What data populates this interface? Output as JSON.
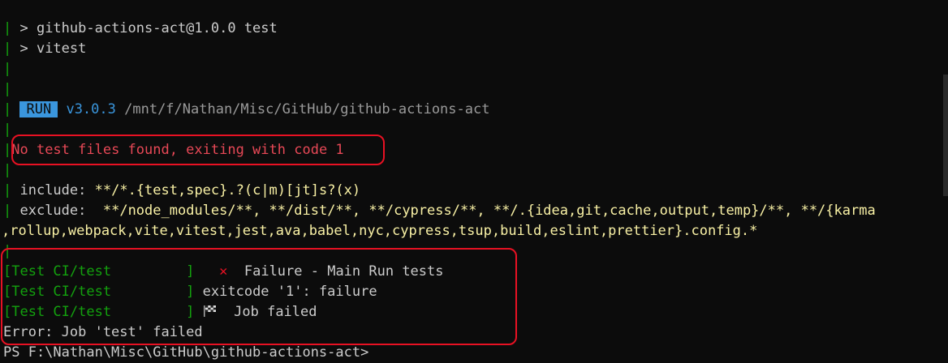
{
  "lines": {
    "l1": "> github-actions-act@1.0.0 test",
    "l2": "> vitest",
    "run_badge": "RUN",
    "run_version": "v3.0.3",
    "run_path": "/mnt/f/Nathan/Misc/GitHub/github-actions-act",
    "no_tests": "No test files found, exiting with code 1",
    "include_label": "include:",
    "include_value": "**/*.{test,spec}.?(c|m)[jt]s?(x)",
    "exclude_label": "exclude:",
    "exclude_value1": "**/node_modules/**, **/dist/**, **/cypress/**, **/.{idea,git,cache,output,temp}/**, **/{karma",
    "exclude_value2": ",rollup,webpack,vite,vitest,jest,ava,babel,nyc,cypress,tsup,build,eslint,prettier}.config.*",
    "ci_prefix": "[Test CI/test         ]",
    "ci_line1": "Failure - Main Run tests",
    "ci_line2": "exitcode '1': failure",
    "ci_line3": "Job failed",
    "error_line": "Error: Job 'test' failed",
    "prompt": "PS F:\\Nathan\\Misc\\GitHub\\github-actions-act>"
  },
  "icons": {
    "failure": "x-mark-icon",
    "flag": "checkered-flag-icon"
  },
  "colors": {
    "background": "#0c0c0c",
    "green": "#13a10e",
    "yellow": "#f9f1a5",
    "cyan": "#3a96dd",
    "red": "#e74856",
    "highlight_box": "#e81123"
  }
}
